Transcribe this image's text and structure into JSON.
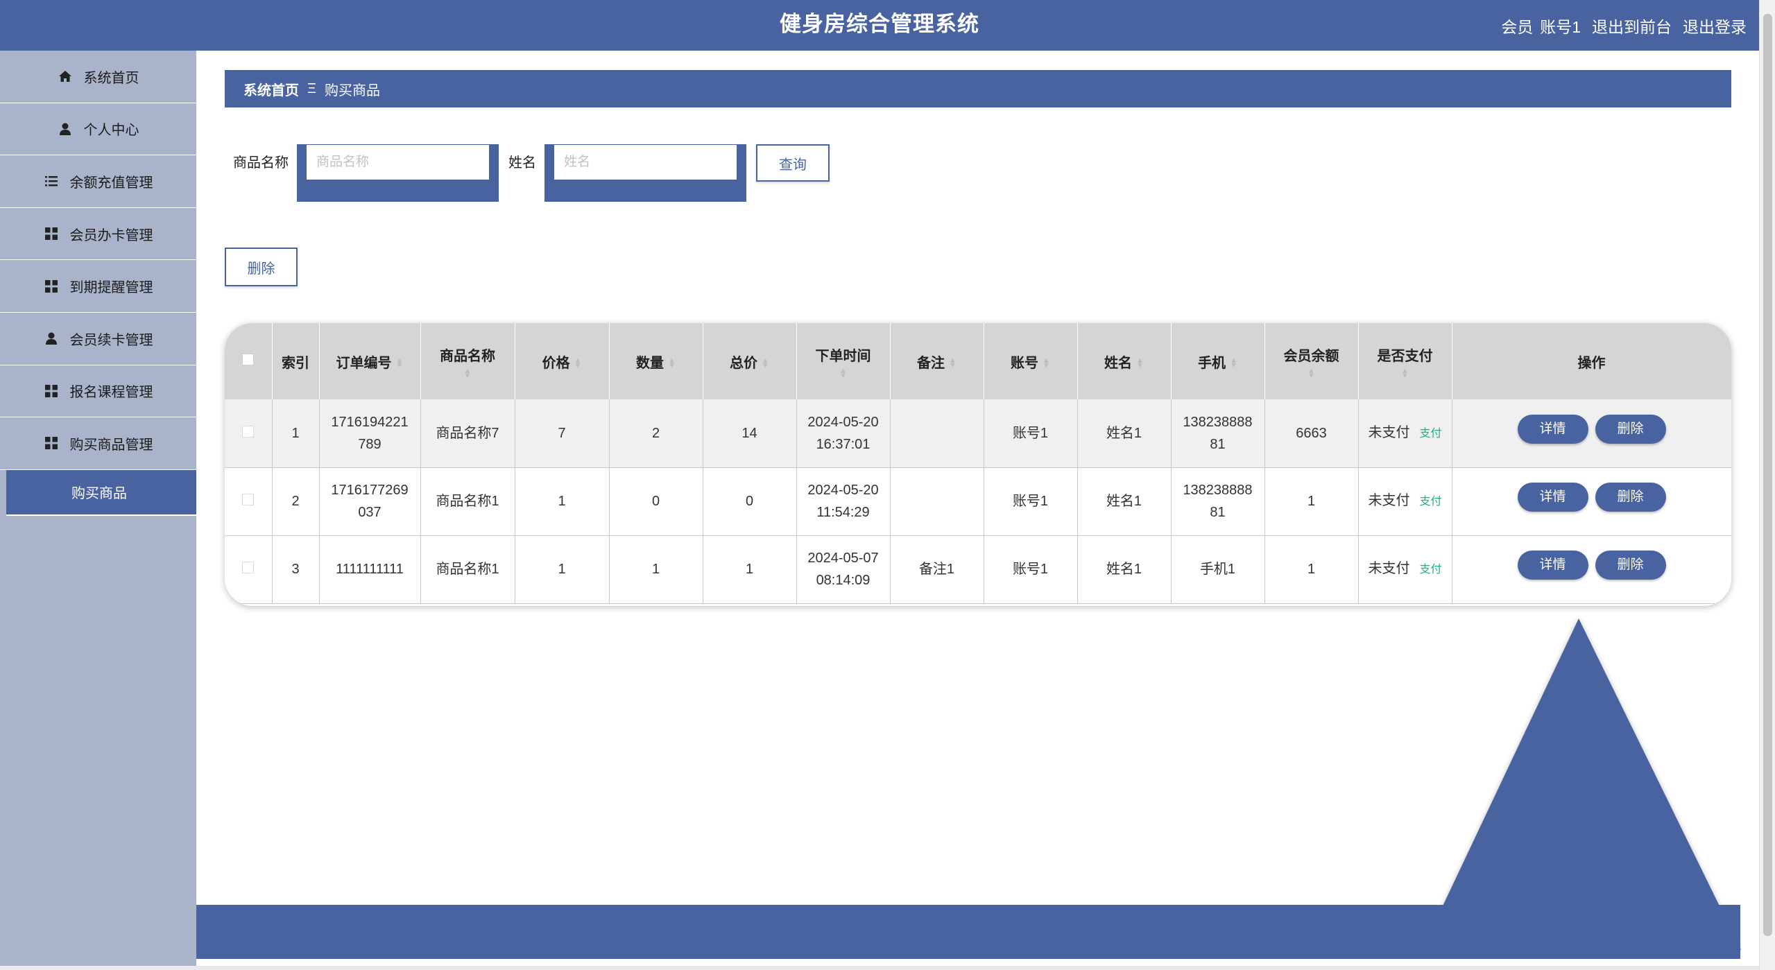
{
  "header": {
    "title": "健身房综合管理系统",
    "user_role": "会员",
    "user_name": "账号1",
    "front_link": "退出到前台",
    "logout_link": "退出登录"
  },
  "sidebar": {
    "items": [
      {
        "label": "系统首页",
        "icon": "home-icon"
      },
      {
        "label": "个人中心",
        "icon": "user-icon"
      },
      {
        "label": "余额充值管理",
        "icon": "list-icon"
      },
      {
        "label": "会员办卡管理",
        "icon": "grid-icon"
      },
      {
        "label": "到期提醒管理",
        "icon": "grid-icon"
      },
      {
        "label": "会员续卡管理",
        "icon": "user-icon"
      },
      {
        "label": "报名课程管理",
        "icon": "grid-icon"
      },
      {
        "label": "购买商品管理",
        "icon": "grid-icon"
      }
    ],
    "active_sub": "购买商品"
  },
  "breadcrumb": {
    "home": "系统首页",
    "separator": "Ξ",
    "current": "购买商品"
  },
  "search": {
    "product_label": "商品名称",
    "product_placeholder": "商品名称",
    "name_label": "姓名",
    "name_placeholder": "姓名",
    "query_button": "查询"
  },
  "toolbar": {
    "delete_button": "删除"
  },
  "table": {
    "headers": [
      "索引",
      "订单编号",
      "商品名称",
      "价格",
      "数量",
      "总价",
      "下单时间",
      "备注",
      "账号",
      "姓名",
      "手机",
      "会员余额",
      "是否支付",
      "操作"
    ],
    "rows": [
      {
        "index": "1",
        "order_no": "1716194221789",
        "order_no_l1": "1716194221",
        "order_no_l2": "789",
        "product": "商品名称7",
        "price": "7",
        "qty": "2",
        "total": "14",
        "time_date": "2024-05-20",
        "time_clock": "16:37:01",
        "note": "",
        "account": "账号1",
        "name": "姓名1",
        "phone_l1": "138238888",
        "phone_l2": "81",
        "balance": "6663",
        "paid": "未支付",
        "pay_action": "支付",
        "detail": "详情",
        "delete": "删除"
      },
      {
        "index": "2",
        "order_no": "1716177269037",
        "order_no_l1": "1716177269",
        "order_no_l2": "037",
        "product": "商品名称1",
        "price": "1",
        "qty": "0",
        "total": "0",
        "time_date": "2024-05-20",
        "time_clock": "11:54:29",
        "note": "",
        "account": "账号1",
        "name": "姓名1",
        "phone_l1": "138238888",
        "phone_l2": "81",
        "balance": "1",
        "paid": "未支付",
        "pay_action": "支付",
        "detail": "详情",
        "delete": "删除"
      },
      {
        "index": "3",
        "order_no": "1111111111",
        "order_no_l1": "1111111111",
        "order_no_l2": "",
        "product": "商品名称1",
        "price": "1",
        "qty": "1",
        "total": "1",
        "time_date": "2024-05-07",
        "time_clock": "08:14:09",
        "note": "备注1",
        "account": "账号1",
        "name": "姓名1",
        "phone_l1": "手机1",
        "phone_l2": "",
        "balance": "1",
        "paid": "未支付",
        "pay_action": "支付",
        "detail": "详情",
        "delete": "删除"
      }
    ]
  },
  "colors": {
    "primary": "#4962a0",
    "sidebar_bg": "#a9b4ca",
    "pay_link": "#20b27c",
    "table_header": "#d5d5d5"
  }
}
